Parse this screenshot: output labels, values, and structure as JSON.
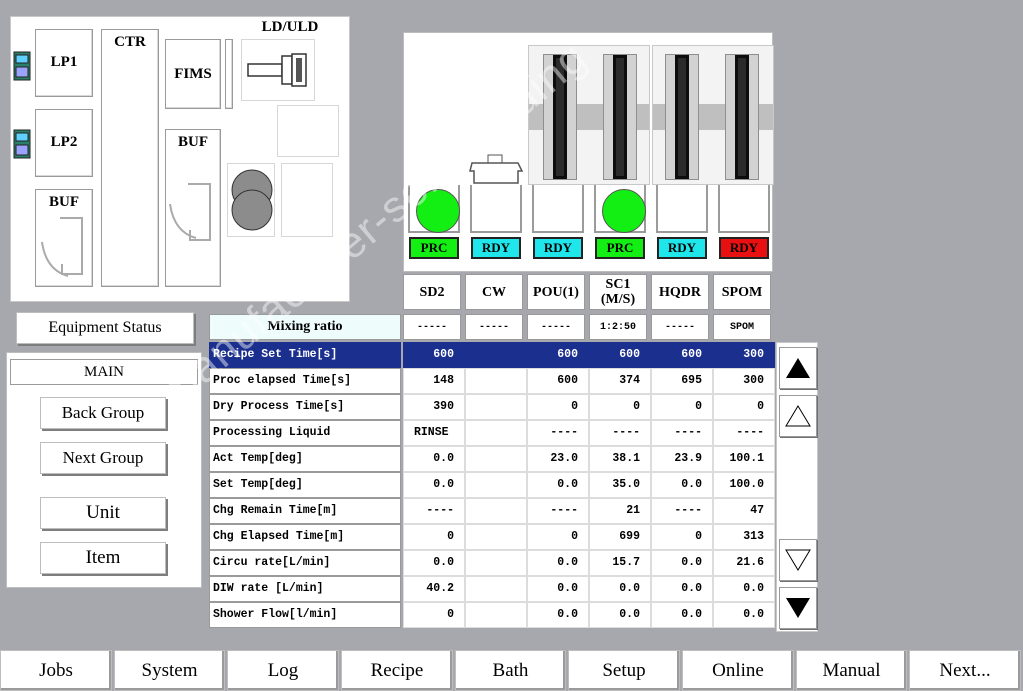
{
  "map": {
    "ld_uld": "LD/ULD",
    "lp1": "LP1",
    "lp2": "LP2",
    "ctr": "CTR",
    "fims": "FIMS",
    "buf_left": "BUF",
    "buf_right": "BUF"
  },
  "equipment_status": "Equipment Status",
  "nav": {
    "main": "MAIN",
    "back_group": "Back Group",
    "next_group": "Next Group",
    "unit": "Unit",
    "item": "Item"
  },
  "colors": {
    "prc": "#13ef13",
    "rdy": "#1fe6ea",
    "alarm_rdy": "#e81010",
    "selected_row": "#1b2f8e"
  },
  "baths": [
    {
      "name": "SD2",
      "status": "PRC",
      "status_color": "#13ef13",
      "mixing": "-----",
      "has_wafer": true
    },
    {
      "name": "CW",
      "status": "RDY",
      "status_color": "#1fe6ea",
      "mixing": "-----",
      "has_wafer": false
    },
    {
      "name": "POU(1)",
      "status": "RDY",
      "status_color": "#1fe6ea",
      "mixing": "-----",
      "has_wafer": false
    },
    {
      "name": "SC1\n(M/S)",
      "status": "PRC",
      "status_color": "#13ef13",
      "mixing": "1:2:50",
      "has_wafer": true
    },
    {
      "name": "HQDR",
      "status": "RDY",
      "status_color": "#1fe6ea",
      "mixing": "-----",
      "has_wafer": false
    },
    {
      "name": "SPOM",
      "status": "RDY",
      "status_color": "#e81010",
      "mixing": "SPOM",
      "has_wafer": false
    }
  ],
  "mixing_ratio_label": "Mixing ratio",
  "table": {
    "rows": [
      {
        "label": "Recipe Set Time[s]",
        "values": [
          "600",
          "",
          "600",
          "600",
          "600",
          "300"
        ],
        "selected": true
      },
      {
        "label": "Proc elapsed Time[s]",
        "values": [
          "148",
          "",
          "600",
          "374",
          "695",
          "300"
        ]
      },
      {
        "label": "Dry Process Time[s]",
        "values": [
          "390",
          "",
          "0",
          "0",
          "0",
          "0"
        ]
      },
      {
        "label": "Processing Liquid",
        "values": [
          "RINSE",
          "",
          "----",
          "----",
          "----",
          "----"
        ]
      },
      {
        "label": "Act Temp[deg]",
        "values": [
          "0.0",
          "",
          "23.0",
          "38.1",
          "23.9",
          "100.1"
        ]
      },
      {
        "label": "Set Temp[deg]",
        "values": [
          "0.0",
          "",
          "0.0",
          "35.0",
          "0.0",
          "100.0"
        ]
      },
      {
        "label": "Chg Remain Time[m]",
        "values": [
          "----",
          "",
          "----",
          "21",
          "----",
          "47"
        ]
      },
      {
        "label": "Chg Elapsed Time[m]",
        "values": [
          "0",
          "",
          "0",
          "699",
          "0",
          "313"
        ]
      },
      {
        "label": "Circu rate[L/min]",
        "values": [
          "0.0",
          "",
          "0.0",
          "15.7",
          "0.0",
          "21.6"
        ]
      },
      {
        "label": "DIW rate [L/min]",
        "values": [
          "40.2",
          "",
          "0.0",
          "0.0",
          "0.0",
          "0.0"
        ]
      },
      {
        "label": "Shower Flow[l/min]",
        "values": [
          "0",
          "",
          "0.0",
          "0.0",
          "0.0",
          "0.0"
        ]
      }
    ]
  },
  "bottom_tabs": [
    "Jobs",
    "System",
    "Log",
    "Recipe",
    "Bath",
    "Setup",
    "Online",
    "Manual",
    "Next..."
  ],
  "icons": {
    "scroll_top": "triangle-filled-up-icon",
    "scroll_up": "triangle-outline-up-icon",
    "scroll_down": "triangle-outline-down-icon",
    "scroll_bottom": "triangle-filled-down-icon"
  },
  "watermark": "manufacturer-semi-trading"
}
